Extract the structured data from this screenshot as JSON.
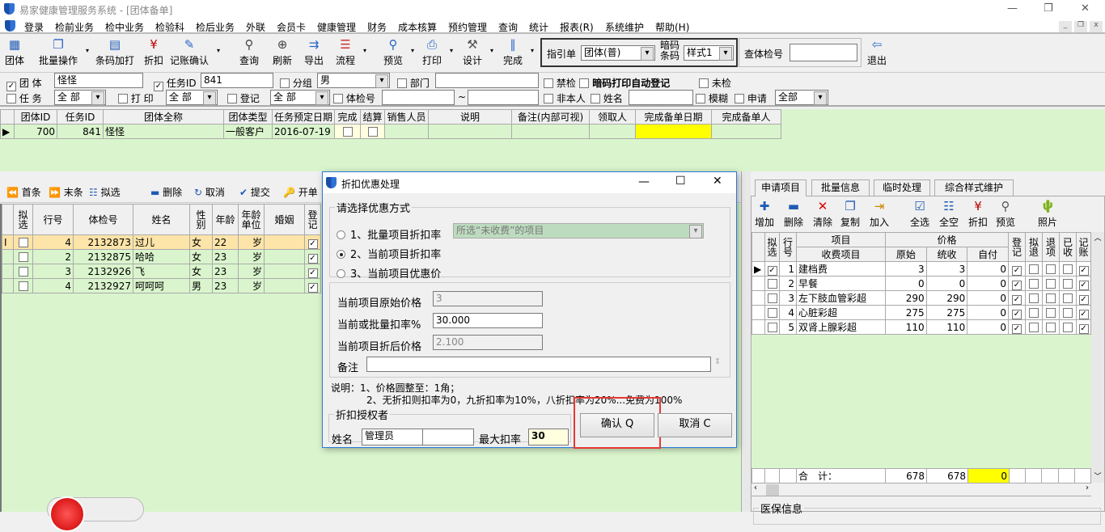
{
  "window": {
    "title": "易家健康管理服务系统 - [团体备单]"
  },
  "menu": [
    "登录",
    "检前业务",
    "检中业务",
    "检验科",
    "检后业务",
    "外联",
    "会员卡",
    "健康管理",
    "财务",
    "成本核算",
    "预约管理",
    "查询",
    "统计",
    "报表(R)",
    "系统维护",
    "帮助(H)"
  ],
  "toolbar": {
    "items": [
      {
        "label": "团体",
        "icon": "group-icon"
      },
      {
        "label": "批量操作",
        "icon": "batch-icon"
      },
      {
        "label": "条码加打",
        "icon": "barcode-icon"
      },
      {
        "label": "折扣",
        "icon": "discount-icon"
      },
      {
        "label": "记账确认",
        "icon": "pen-icon"
      },
      {
        "label": "查询",
        "icon": "search-icon"
      },
      {
        "label": "刷新",
        "icon": "refresh-icon"
      },
      {
        "label": "导出",
        "icon": "export-icon"
      },
      {
        "label": "流程",
        "icon": "flow-icon"
      },
      {
        "label": "预览",
        "icon": "preview-icon"
      },
      {
        "label": "打印",
        "icon": "printer-icon"
      },
      {
        "label": "设计",
        "icon": "hammer-icon"
      },
      {
        "label": "完成",
        "icon": "clip-icon"
      }
    ],
    "guide_label": "指引单",
    "guide_value": "团体(普)",
    "code_label_1": "暗码",
    "code_label_2": "条码",
    "code_value": "样式1",
    "query_label": "查体检号",
    "query_value": "",
    "exit_label": "退出"
  },
  "filters": {
    "group_label": "团 体",
    "group_value": "怪怪",
    "task_id_label": "任务ID",
    "task_id_value": "841",
    "subgroup_label": "分组",
    "subgroup_value": "男",
    "dept_label": "部门",
    "ban_label": "禁检",
    "auto_reg_label": "暗码打印自动登记",
    "unchecked_label": "未检",
    "task_label": "任 务",
    "task_value": "全 部",
    "print_label": "打 印",
    "print_value": "全 部",
    "reg_label": "登记",
    "reg_value": "全 部",
    "exam_no_label": "体检号",
    "tilde": "~",
    "not_self_label": "非本人",
    "name_label": "姓名",
    "fuzzy_label": "模糊",
    "apply_label": "申请",
    "apply_value": "全部"
  },
  "group_grid": {
    "headers": [
      "团体ID",
      "任务ID",
      "团体全称",
      "团体类型",
      "任务预定日期",
      "完成",
      "结算",
      "销售人员",
      "说明",
      "备注(内部可视)",
      "领取人",
      "完成备单日期",
      "完成备单人"
    ],
    "rows": [
      [
        "700",
        "841",
        "怪怪",
        "一般客户",
        "2016-07-19",
        "",
        "",
        "",
        "",
        "",
        "",
        "",
        ""
      ]
    ]
  },
  "person_toolbar": [
    "首条",
    "末条",
    "拟选",
    "删除",
    "取消",
    "提交",
    "开单"
  ],
  "person_grid": {
    "headers": [
      "拟选",
      "行号",
      "体检号",
      "姓名",
      "性别",
      "年龄",
      "年龄单位",
      "婚姻",
      "登记"
    ],
    "rows": [
      [
        "4",
        "2132873",
        "过儿",
        "女",
        "22",
        "岁"
      ],
      [
        "2",
        "2132875",
        "哈哈",
        "女",
        "23",
        "岁"
      ],
      [
        "3",
        "2132926",
        "飞",
        "女",
        "23",
        "岁"
      ],
      [
        "4",
        "2132927",
        "呵呵呵",
        "男",
        "23",
        "岁"
      ]
    ]
  },
  "dialog": {
    "title": "折扣优惠处理",
    "mode_legend": "请选择优惠方式",
    "options": [
      "1、批量项目折扣率",
      "2、当前项目折扣率",
      "3、当前项目优惠价"
    ],
    "selected_option": 2,
    "batch_select": "所选“未收费”的项目",
    "orig_label": "当前项目原始价格",
    "orig_value": "3",
    "rate_label": "当前或批量扣率%",
    "rate_value": "30.000",
    "after_label": "当前项目折后价格",
    "after_value": "2.100",
    "note_label": "备注",
    "note_value": "",
    "help_1": "说明：1、价格圆整至：1角；",
    "help_2": "2、无折扣则扣率为0，九折扣率为10%，八折扣率为20%...免费为100%",
    "auth_legend": "折扣授权者",
    "name_label": "姓名",
    "name_value": "管理员",
    "max_label": "最大扣率",
    "max_value": "30",
    "ok": "确认 Q",
    "cancel": "取消 C"
  },
  "right": {
    "tabs": [
      "申请项目",
      "批量信息",
      "临时处理",
      "综合样式维护"
    ],
    "toolbar": [
      "增加",
      "删除",
      "清除",
      "复制",
      "加入",
      "全选",
      "全空",
      "折扣",
      "预览",
      "照片"
    ],
    "headers_top": [
      "拟选",
      "行号",
      "项目",
      "价格",
      "登记",
      "拟退",
      "退项",
      "已收",
      "记账"
    ],
    "headers_sub": [
      "收费项目",
      "原始",
      "统收",
      "自付"
    ],
    "rows": [
      [
        "1",
        "建档费",
        "3",
        "3",
        "0"
      ],
      [
        "2",
        "早餐",
        "0",
        "0",
        "0"
      ],
      [
        "3",
        "左下肢血管彩超",
        "290",
        "290",
        "0"
      ],
      [
        "4",
        "心脏彩超",
        "275",
        "275",
        "0"
      ],
      [
        "5",
        "双肾上腺彩超",
        "110",
        "110",
        "0"
      ]
    ],
    "total_label": "合　计：",
    "total_orig": "678",
    "total_unified": "678",
    "total_self": "0",
    "insurance_legend": "医保信息"
  },
  "colors": {
    "grid_green": "#daf5cd",
    "highlight_yellow": "#ffff00",
    "selected_row": "#fde4a8",
    "focus_red": "#e53935"
  }
}
